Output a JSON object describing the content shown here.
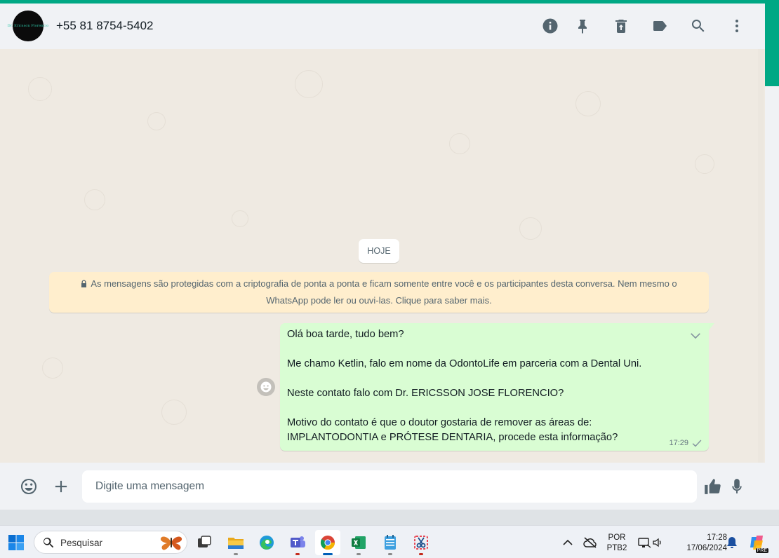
{
  "header": {
    "avatar_text": "Dr. Ericsson Florencio",
    "contact_name": "+55 81 8754-5402"
  },
  "chat": {
    "date_chip": "HOJE",
    "e2e_notice_line1": "As mensagens são protegidas com a criptografia de ponta a ponta e ficam somente entre você e os participantes desta conversa. Nem mesmo o",
    "e2e_notice_line2": "WhatsApp pode ler ou ouvi-las. Clique para saber mais.",
    "message": {
      "lines": [
        "Olá boa tarde, tudo bem?",
        "",
        "Me chamo Ketlin, falo em nome da OdontoLife em parceria com a Dental Uni.",
        "",
        "Neste contato falo com Dr. ERICSSON JOSE FLORENCIO?",
        "",
        "Motivo do contato é que o doutor gostaria de remover as áreas de:",
        "IMPLANTODONTIA e PRÓTESE DENTARIA, procede esta informação?"
      ],
      "time": "17:29",
      "status": "sent"
    }
  },
  "footer": {
    "placeholder": "Digite uma mensagem"
  },
  "taskbar": {
    "search_label": "Pesquisar",
    "language_line1": "POR",
    "language_line2": "PTB2",
    "time": "17:28",
    "date": "17/06/2024",
    "copilot_badge": "PRE"
  },
  "colors": {
    "accent": "#00a884",
    "outgoing_bubble": "#d9fdd3",
    "notice_bg": "#ffeecd",
    "chat_bg": "#efeae2"
  }
}
